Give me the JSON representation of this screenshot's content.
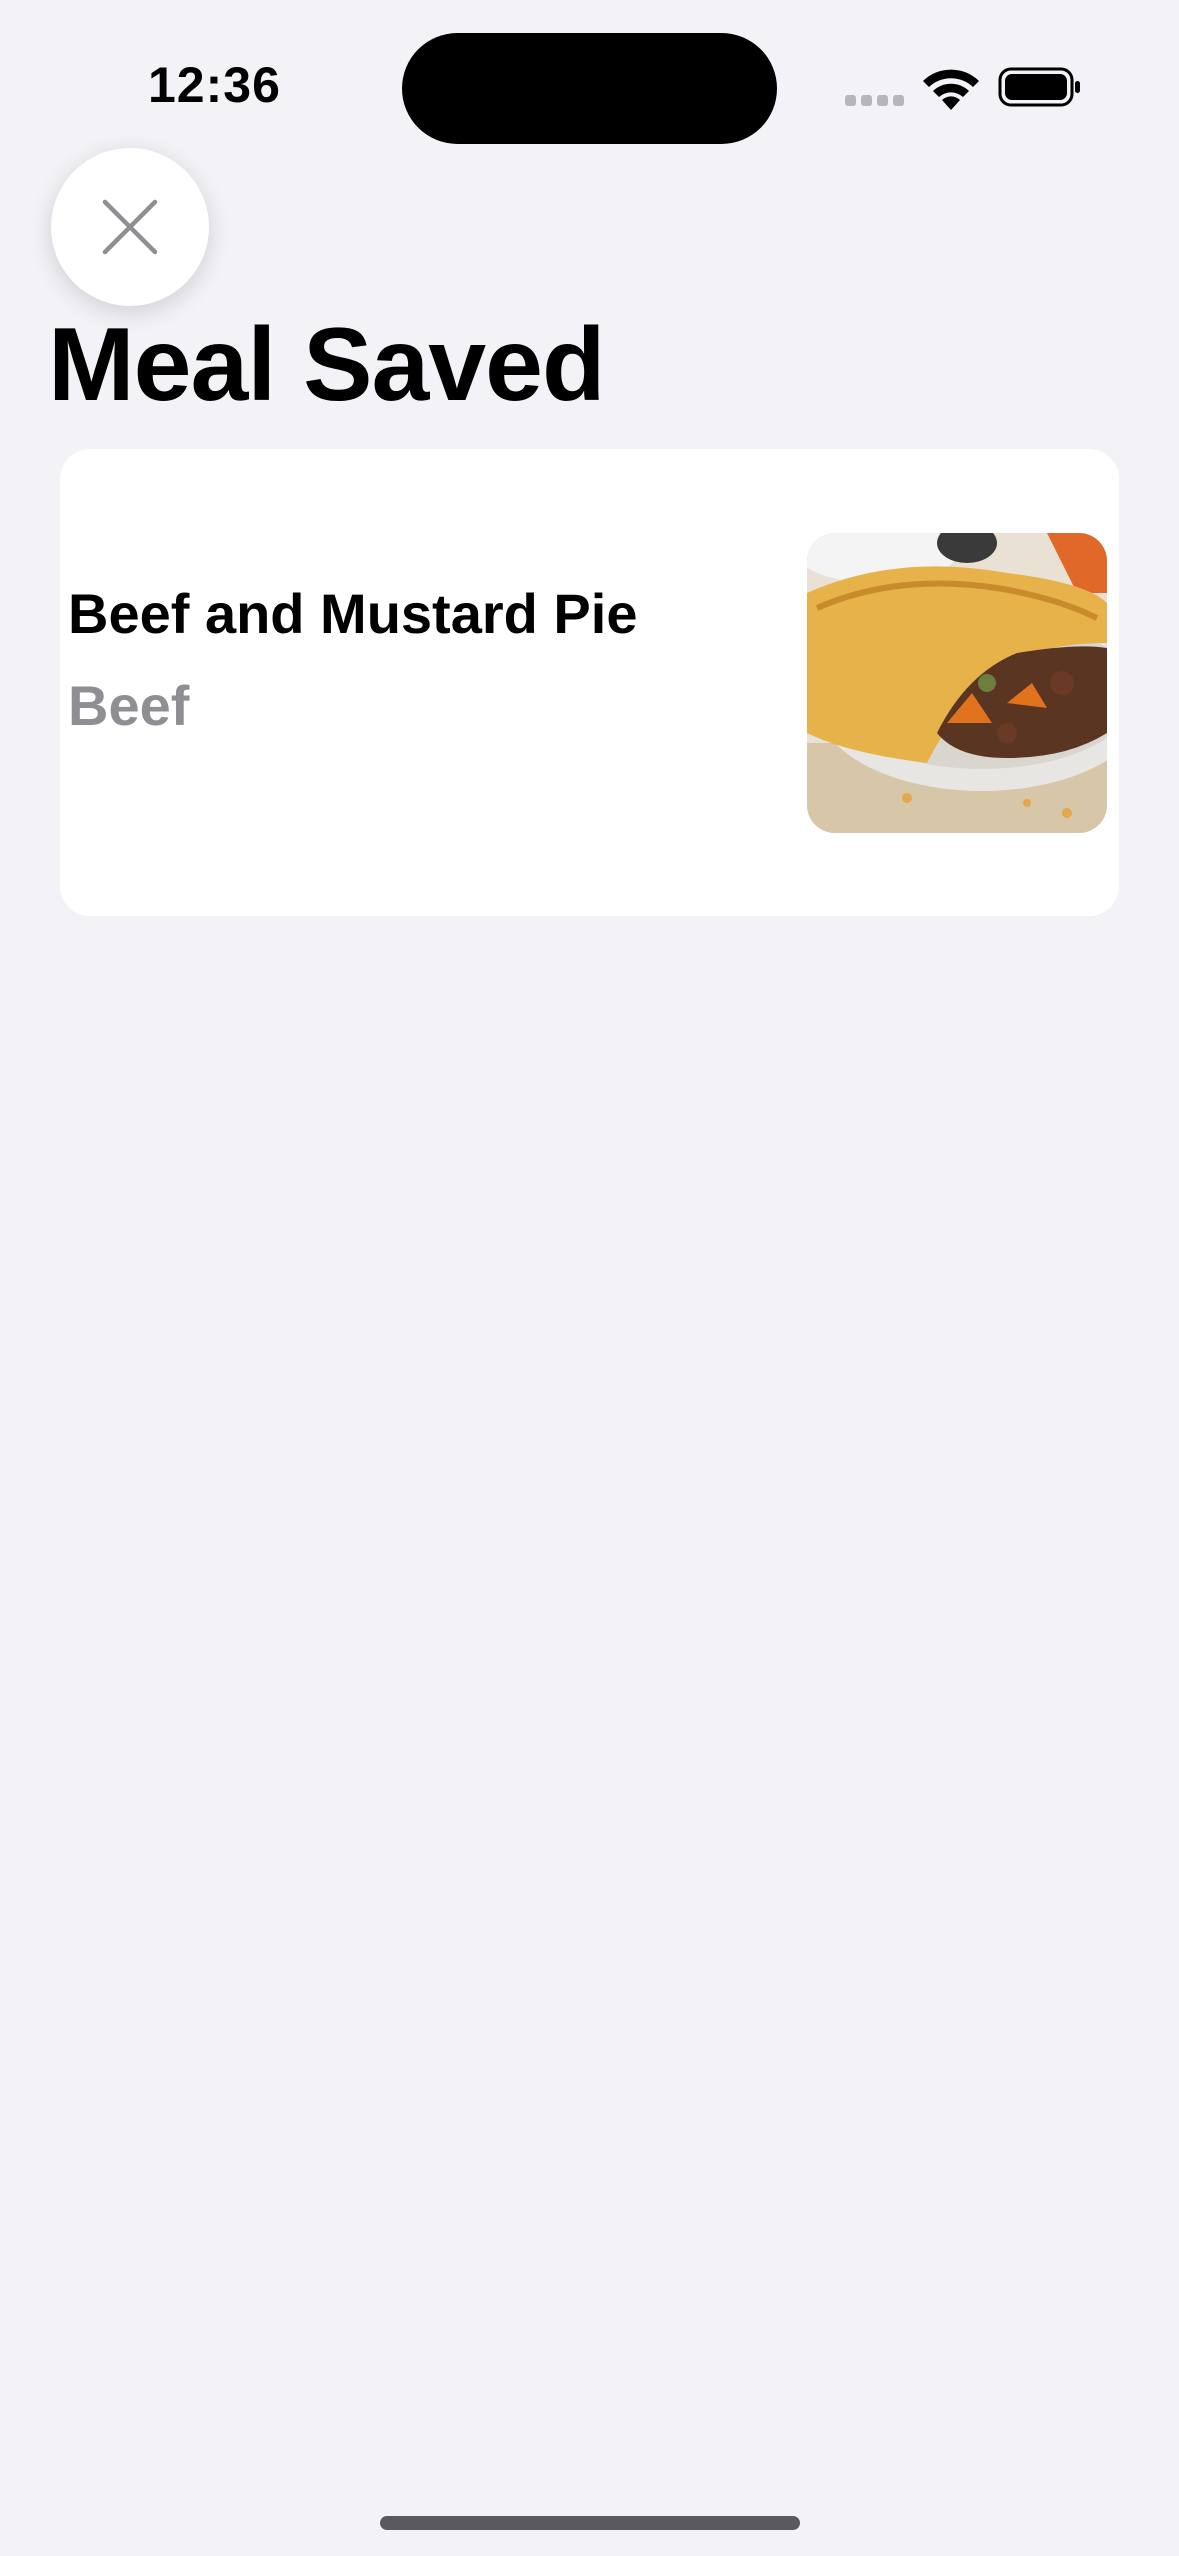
{
  "status_bar": {
    "time": "12:36",
    "icons": [
      "cellular-signal-icon",
      "wifi-icon",
      "battery-icon"
    ]
  },
  "header": {
    "close_icon": "close-icon",
    "title": "Meal Saved"
  },
  "meal": {
    "name": "Beef and Mustard Pie",
    "category": "Beef",
    "thumbnail_icon": "meal-thumbnail"
  },
  "colors": {
    "background": "#f2f2f7",
    "card": "#ffffff",
    "primary_text": "#000000",
    "secondary_text": "#8e8e93"
  }
}
